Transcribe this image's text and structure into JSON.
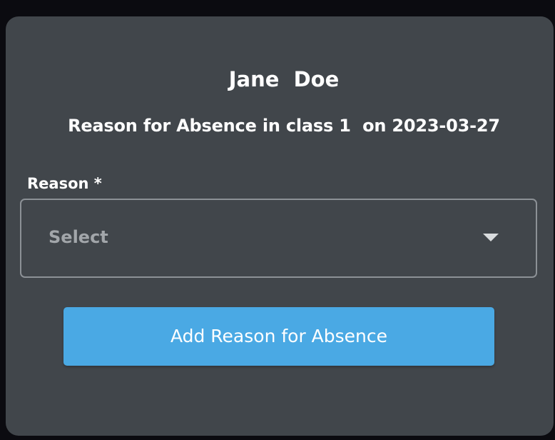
{
  "dialog": {
    "student_name": "Jane  Doe",
    "subtitle": "Reason for Absence in class 1  on 2023-03-27",
    "reason_field": {
      "label": "Reason *",
      "value": "Select",
      "icon": "caret-down-icon"
    },
    "submit_label": "Add Reason for Absence"
  },
  "colors": {
    "page_background": "#0b0b10",
    "dialog_background": "#41464b",
    "button": "#4aa9e4",
    "field_border": "#8c9196",
    "placeholder_text": "#a2a6aa"
  }
}
